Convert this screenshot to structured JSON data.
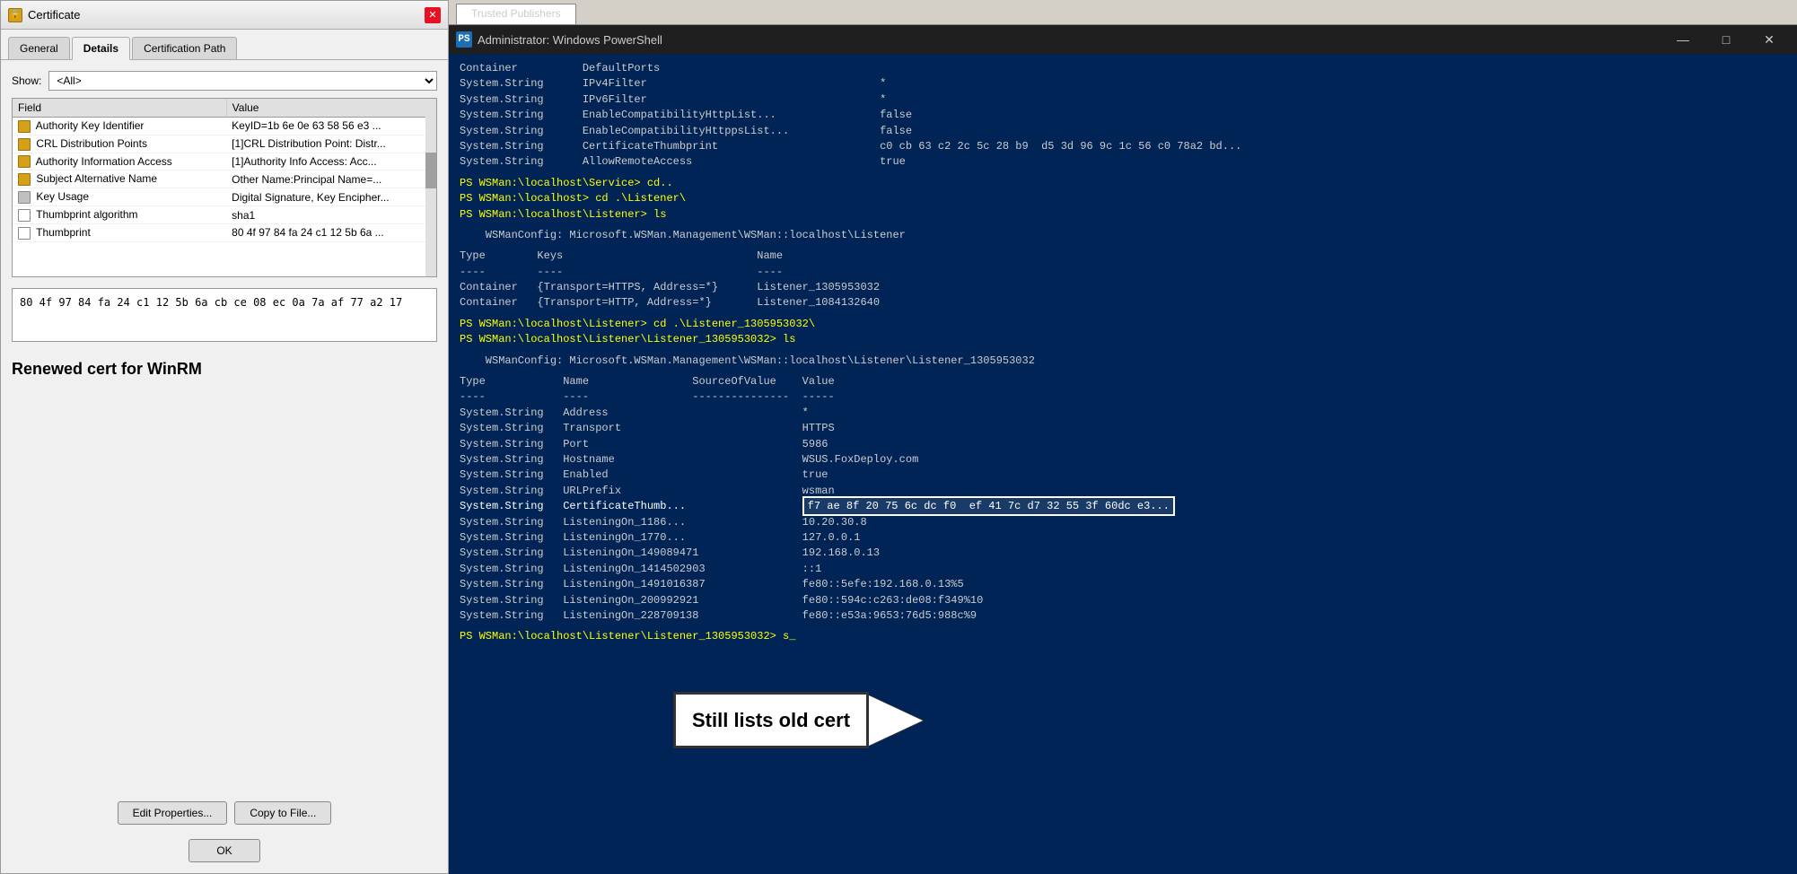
{
  "certDialog": {
    "title": "Certificate",
    "tabs": [
      {
        "label": "General",
        "active": false
      },
      {
        "label": "Details",
        "active": true
      },
      {
        "label": "Certification Path",
        "active": false
      }
    ],
    "showLabel": "Show:",
    "showValue": "<All>",
    "tableHeaders": [
      "Field",
      "Value"
    ],
    "tableRows": [
      {
        "icon": "cert",
        "field": "Authority Key Identifier",
        "value": "KeyID=1b 6e 0e 63 58 56 e3 ..."
      },
      {
        "icon": "cert",
        "field": "CRL Distribution Points",
        "value": "[1]CRL Distribution Point: Distr..."
      },
      {
        "icon": "cert",
        "field": "Authority Information Access",
        "value": "[1]Authority Info Access: Acc..."
      },
      {
        "icon": "cert",
        "field": "Subject Alternative Name",
        "value": "Other Name:Principal Name=..."
      },
      {
        "icon": "key",
        "field": "Key Usage",
        "value": "Digital Signature, Key Encipher..."
      },
      {
        "icon": "doc",
        "field": "Thumbprint algorithm",
        "value": "sha1"
      },
      {
        "icon": "doc",
        "field": "Thumbprint",
        "value": "80 4f 97 84 fa 24 c1 12 5b 6a ..."
      }
    ],
    "valueBoxContent": "80 4f 97 84 fa 24 c1 12 5b 6a cb ce 08 ec 0a\n7a af 77 a2 17",
    "renewedLabel": "Renewed cert for WinRM",
    "editPropertiesBtn": "Edit Properties...",
    "copyToFileBtn": "Copy to File...",
    "okBtn": "OK"
  },
  "psWindow": {
    "title": "Administrator: Windows PowerShell",
    "topTab": "Trusted Publishers",
    "lines": [
      {
        "text": "Container          DefaultPorts",
        "style": "normal"
      },
      {
        "text": "System.String      IPv4Filter                                    *",
        "style": "normal"
      },
      {
        "text": "System.String      IPv6Filter                                    *",
        "style": "normal"
      },
      {
        "text": "System.String      EnableCompatibilityHttpList...                false",
        "style": "normal"
      },
      {
        "text": "System.String      EnableCompatibilityHttppsList...              false",
        "style": "normal"
      },
      {
        "text": "System.String      CertificateThumbprint                         c0 cb 63 c2 2c 5c 28 b9  d5 3d 96 9c 1c 56 c0 78a2 bd...",
        "style": "normal"
      },
      {
        "text": "System.String      AllowRemoteAccess                             true",
        "style": "normal"
      },
      {
        "text": "",
        "style": "empty"
      },
      {
        "text": "PS WSMan:\\localhost\\Service> cd..",
        "style": "prompt"
      },
      {
        "text": "PS WSMan:\\localhost> cd .\\Listener\\",
        "style": "prompt"
      },
      {
        "text": "PS WSMan:\\localhost\\Listener> ls",
        "style": "prompt"
      },
      {
        "text": "",
        "style": "empty"
      },
      {
        "text": "    WSManConfig: Microsoft.WSMan.Management\\WSMan::localhost\\Listener",
        "style": "normal"
      },
      {
        "text": "",
        "style": "empty"
      },
      {
        "text": "Type        Keys                              Name",
        "style": "normal"
      },
      {
        "text": "----        ----                              ----",
        "style": "normal"
      },
      {
        "text": "Container   {Transport=HTTPS, Address=*}      Listener_1305953032",
        "style": "normal"
      },
      {
        "text": "Container   {Transport=HTTP, Address=*}       Listener_1084132640",
        "style": "normal"
      },
      {
        "text": "",
        "style": "empty"
      },
      {
        "text": "PS WSMan:\\localhost\\Listener> cd .\\Listener_1305953032\\",
        "style": "prompt"
      },
      {
        "text": "PS WSMan:\\localhost\\Listener\\Listener_1305953032> ls",
        "style": "prompt"
      },
      {
        "text": "",
        "style": "empty"
      },
      {
        "text": "    WSManConfig: Microsoft.WSMan.Management\\WSMan::localhost\\Listener\\Listener_1305953032",
        "style": "normal"
      },
      {
        "text": "",
        "style": "empty"
      },
      {
        "text": "Type            Name                SourceOfValue    Value",
        "style": "normal"
      },
      {
        "text": "----            ----                ---------------  -----",
        "style": "normal"
      },
      {
        "text": "System.String   Address                              *",
        "style": "normal"
      },
      {
        "text": "System.String   Transport                            HTTPS",
        "style": "normal"
      },
      {
        "text": "System.String   Port                                 5986",
        "style": "normal"
      },
      {
        "text": "System.String   Hostname                             WSUS.FoxDeploy.com",
        "style": "normal"
      },
      {
        "text": "System.String   Enabled                              true",
        "style": "normal"
      },
      {
        "text": "System.String   URLPrefix                            wsman",
        "style": "normal"
      },
      {
        "text": "System.String   CertificateThumb...                  f7 ae 8f 20 75 6c dc f0  ef 41 7c d7 32 55 3f 60dc e3...",
        "style": "highlight"
      },
      {
        "text": "System.String   ListeningOn_1186...                  10.20.30.8",
        "style": "normal"
      },
      {
        "text": "System.String   ListeningOn_1770...                  127.0.0.1",
        "style": "normal"
      },
      {
        "text": "System.String   ListeningOn_149089471                192.168.0.13",
        "style": "normal"
      },
      {
        "text": "System.String   ListeningOn_1414502903               ::1",
        "style": "normal"
      },
      {
        "text": "System.String   ListeningOn_1491016387               fe80::5efe:192.168.0.13%5",
        "style": "normal"
      },
      {
        "text": "System.String   ListeningOn_200992921                fe80::594c:c263:de08:f349%10",
        "style": "normal"
      },
      {
        "text": "System.String   ListeningOn_228709138                fe80::e53a:9653:76d5:988c%9",
        "style": "normal"
      },
      {
        "text": "",
        "style": "empty"
      },
      {
        "text": "PS WSMan:\\localhost\\Listener\\Listener_1305953032> s_",
        "style": "prompt"
      }
    ],
    "annotation": {
      "text": "Still lists old cert",
      "visible": true
    }
  }
}
